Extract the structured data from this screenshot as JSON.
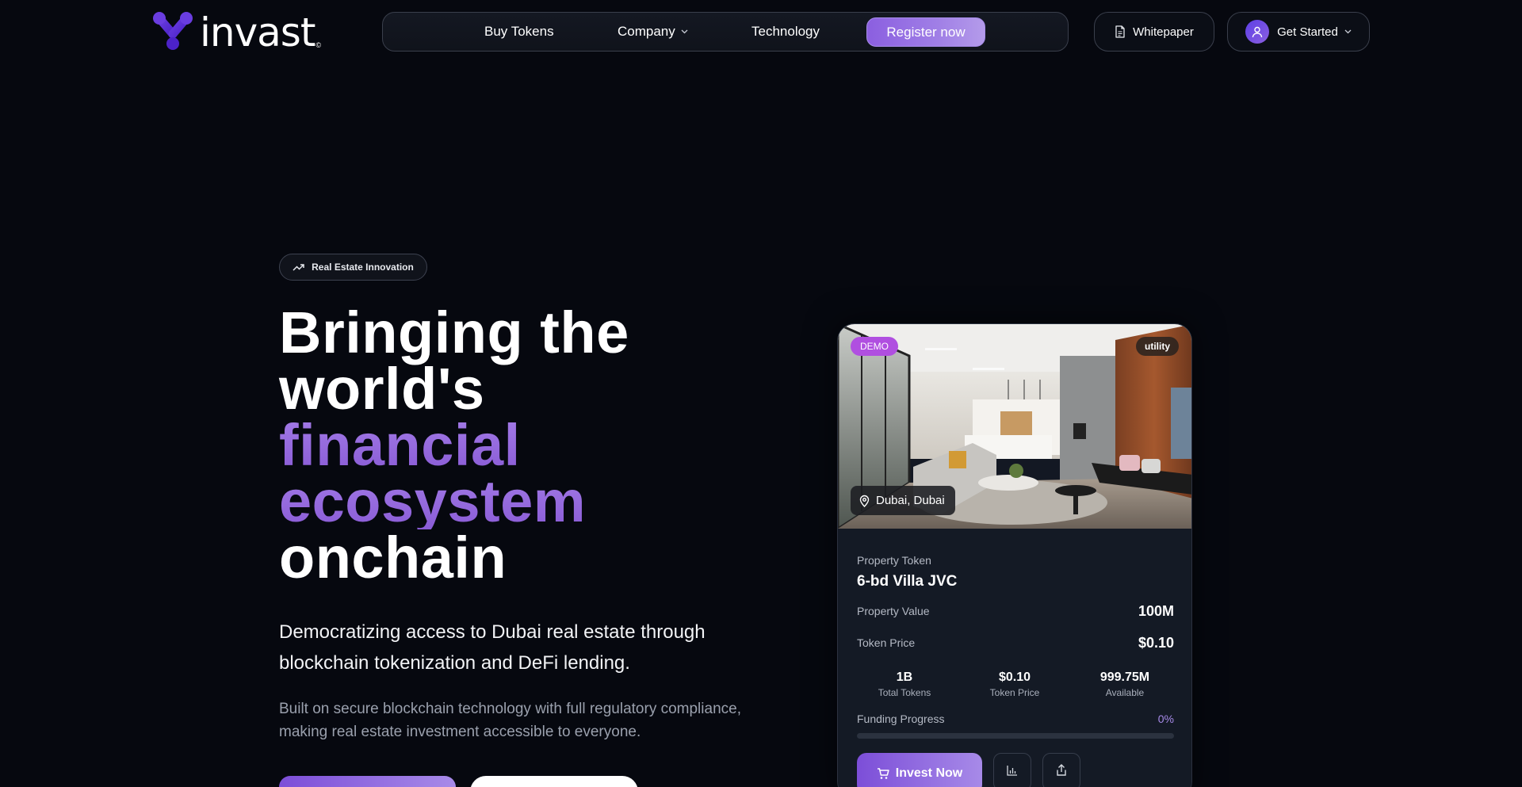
{
  "brand": {
    "name": "invast",
    "mark": "©"
  },
  "nav": {
    "items": [
      {
        "label": "Buy Tokens"
      },
      {
        "label": "Company"
      },
      {
        "label": "Technology"
      }
    ],
    "register_label": "Register now",
    "whitepaper_label": "Whitepaper",
    "get_started_label": "Get Started"
  },
  "hero": {
    "badge": "Real Estate Innovation",
    "title_lines": [
      "Bringing the",
      "world's",
      "financial",
      "ecosystem",
      "onchain"
    ],
    "subtitle": "Democratizing access to Dubai real estate through blockchain tokenization and DeFi lending.",
    "body": "Built on secure blockchain technology with full regulatory compliance, making real estate investment accessible to everyone."
  },
  "card": {
    "tag_demo": "DEMO",
    "tag_type": "utility",
    "location": "Dubai, Dubai",
    "kind_label": "Property Token",
    "name": "6-bd Villa JVC",
    "property_value_label": "Property Value",
    "property_value": "100M",
    "token_price_label": "Token Price",
    "token_price": "$0.10",
    "stats": [
      {
        "value": "1B",
        "caption": "Total Tokens"
      },
      {
        "value": "$0.10",
        "caption": "Token Price"
      },
      {
        "value": "999.75M",
        "caption": "Available"
      }
    ],
    "funding_label": "Funding Progress",
    "funding_pct": "0%",
    "funding_fraction": 0,
    "invest_label": "Invest Now"
  },
  "colors": {
    "accent": "#8b5fe0",
    "accent_light": "#a78ae8",
    "background": "#06080f",
    "demo_tag": "#b04fe0"
  },
  "icons": {
    "nav_chevron": "chevron-down-icon",
    "whitepaper": "document-icon",
    "user": "user-icon",
    "badge": "trending-up-icon",
    "location": "map-pin-icon",
    "invest": "cart-icon",
    "chart": "bar-chart-icon",
    "share": "share-icon"
  }
}
